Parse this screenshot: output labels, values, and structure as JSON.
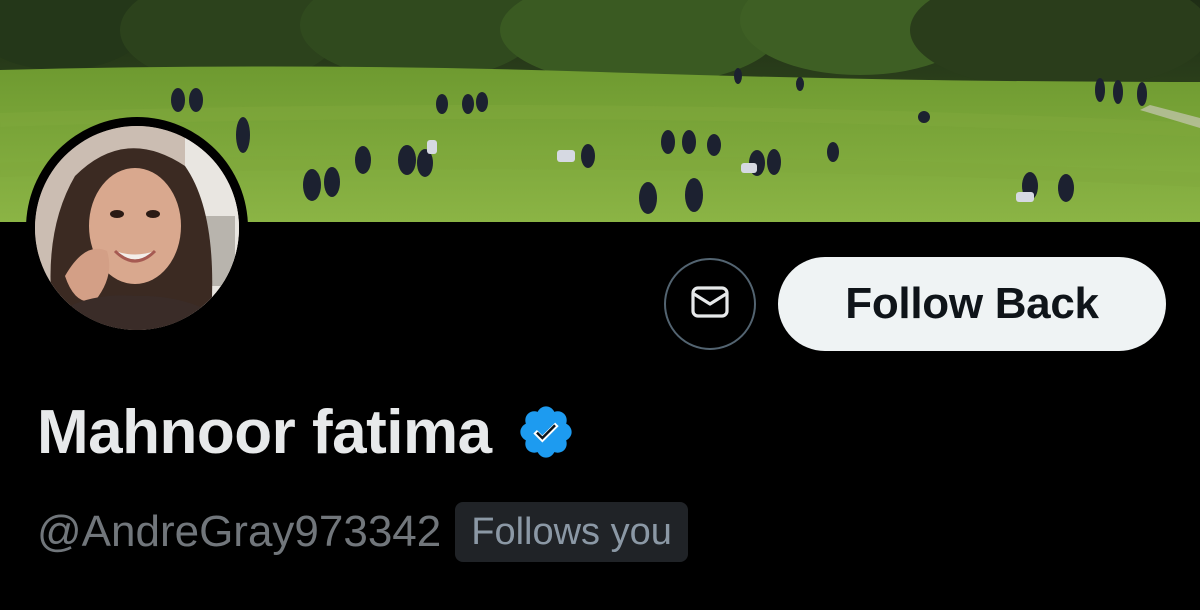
{
  "profile": {
    "display_name": "Mahnoor fatima",
    "handle": "@AndreGray973342",
    "follows_you_label": "Follows you",
    "verified": true
  },
  "actions": {
    "follow_label": "Follow Back",
    "message_icon": "envelope-icon"
  },
  "banner": {
    "description_icon": "park-lawn-photo"
  },
  "colors": {
    "background": "#000000",
    "name_text": "#e7e9ea",
    "secondary_text": "#71767b",
    "follow_button_bg": "#eff3f4",
    "follow_button_text": "#0f1419",
    "verified_badge": "#1d9bf0",
    "badge_bg": "#202327",
    "dm_border": "#536471"
  }
}
